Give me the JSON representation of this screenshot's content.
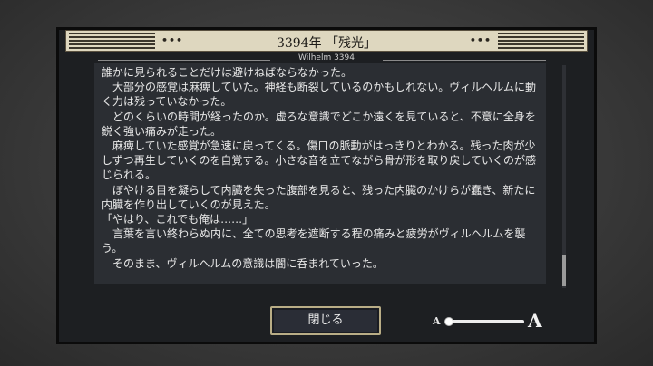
{
  "header": {
    "title": "3394年 「残光」",
    "dots_left": "•••",
    "dots_right": "•••",
    "subtitle": "Wilhelm 3394"
  },
  "body_text": "誰かに見られることだけは避けねばならなかった。\n　大部分の感覚は麻痺していた。神経も断裂しているのかもしれない。ヴィルヘルムに動く力は残っていなかった。\n　どのくらいの時間が経ったのか。虚ろな意識でどこか遠くを見ていると、不意に全身を鋭く強い痛みが走った。\n　麻痺していた感覚が急速に戻ってくる。傷口の脈動がはっきりとわかる。残った肉が少しずつ再生していくのを自覚する。小さな音を立てながら骨が形を取り戻していくのが感じられる。\n　ぼやける目を凝らして内臓を失った腹部を見ると、残った内臓のかけらが蠢き、新たに内臓を作り出していくのが見えた。\n「やはり、これでも俺は……」\n　言葉を言い終わらぬ内に、全ての思考を遮断する程の痛みと疲労がヴィルヘルムを襲う。\n　そのまま、ヴィルヘルムの意識は闇に呑まれていった。\n\n「―了―」",
  "footer": {
    "close_label": "閉じる",
    "font_size_small_label": "A",
    "font_size_large_label": "A",
    "font_size_level": 0.0
  },
  "scrollbar": {
    "position": 1.0
  }
}
